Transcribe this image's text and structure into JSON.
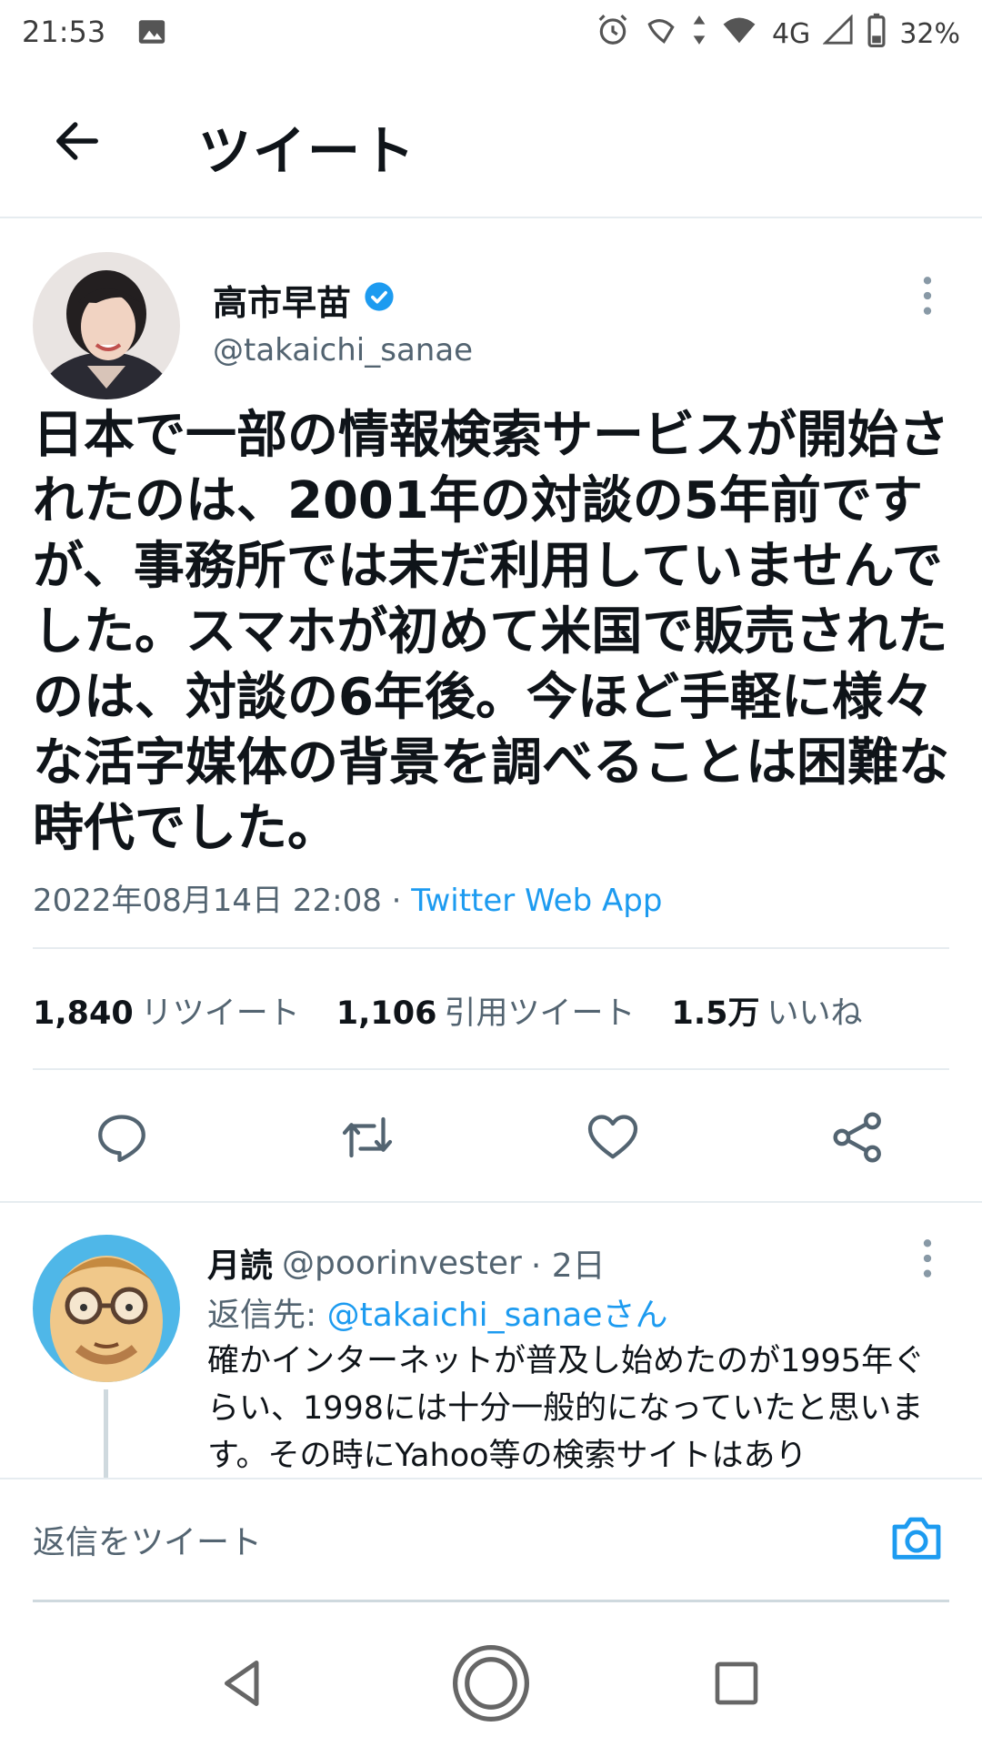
{
  "status_bar": {
    "time": "21:53",
    "network": "4G",
    "battery": "32%"
  },
  "header": {
    "title": "ツイート"
  },
  "main_tweet": {
    "author_name": "高市早苗",
    "handle": "@takaichi_sanae",
    "text": "日本で一部の情報検索サービスが開始されたのは、2001年の対談の5年前ですが、事務所では未だ利用していませんでした。スマホが初めて米国で販売されたのは、対談の6年後。今ほど手軽に様々な活字媒体の背景を調べることは困難な時代でした。",
    "timestamp": "2022年08月14日 22:08",
    "separator": " · ",
    "source": "Twitter Web App",
    "stats": {
      "retweets_num": "1,840",
      "retweets_label": "リツイート",
      "quotes_num": "1,106",
      "quotes_label": "引用ツイート",
      "likes_num": "1.5万",
      "likes_label": "いいね"
    }
  },
  "reply": {
    "name": "月読",
    "handle": "@poorinvester",
    "time": "· 2日",
    "reply_to_prefix": "返信先: ",
    "reply_to": "@takaichi_sanaeさん",
    "text": "確かインターネットが普及し始めたのが1995年ぐらい、1998には十分一般的になっていたと思います。その時にYahoo等の検索サイトはあり"
  },
  "composer": {
    "placeholder": "返信をツイート"
  },
  "colors": {
    "accent": "#1d9bf0",
    "text": "#0f1419",
    "muted": "#536471",
    "divider": "#e6ecf0"
  }
}
